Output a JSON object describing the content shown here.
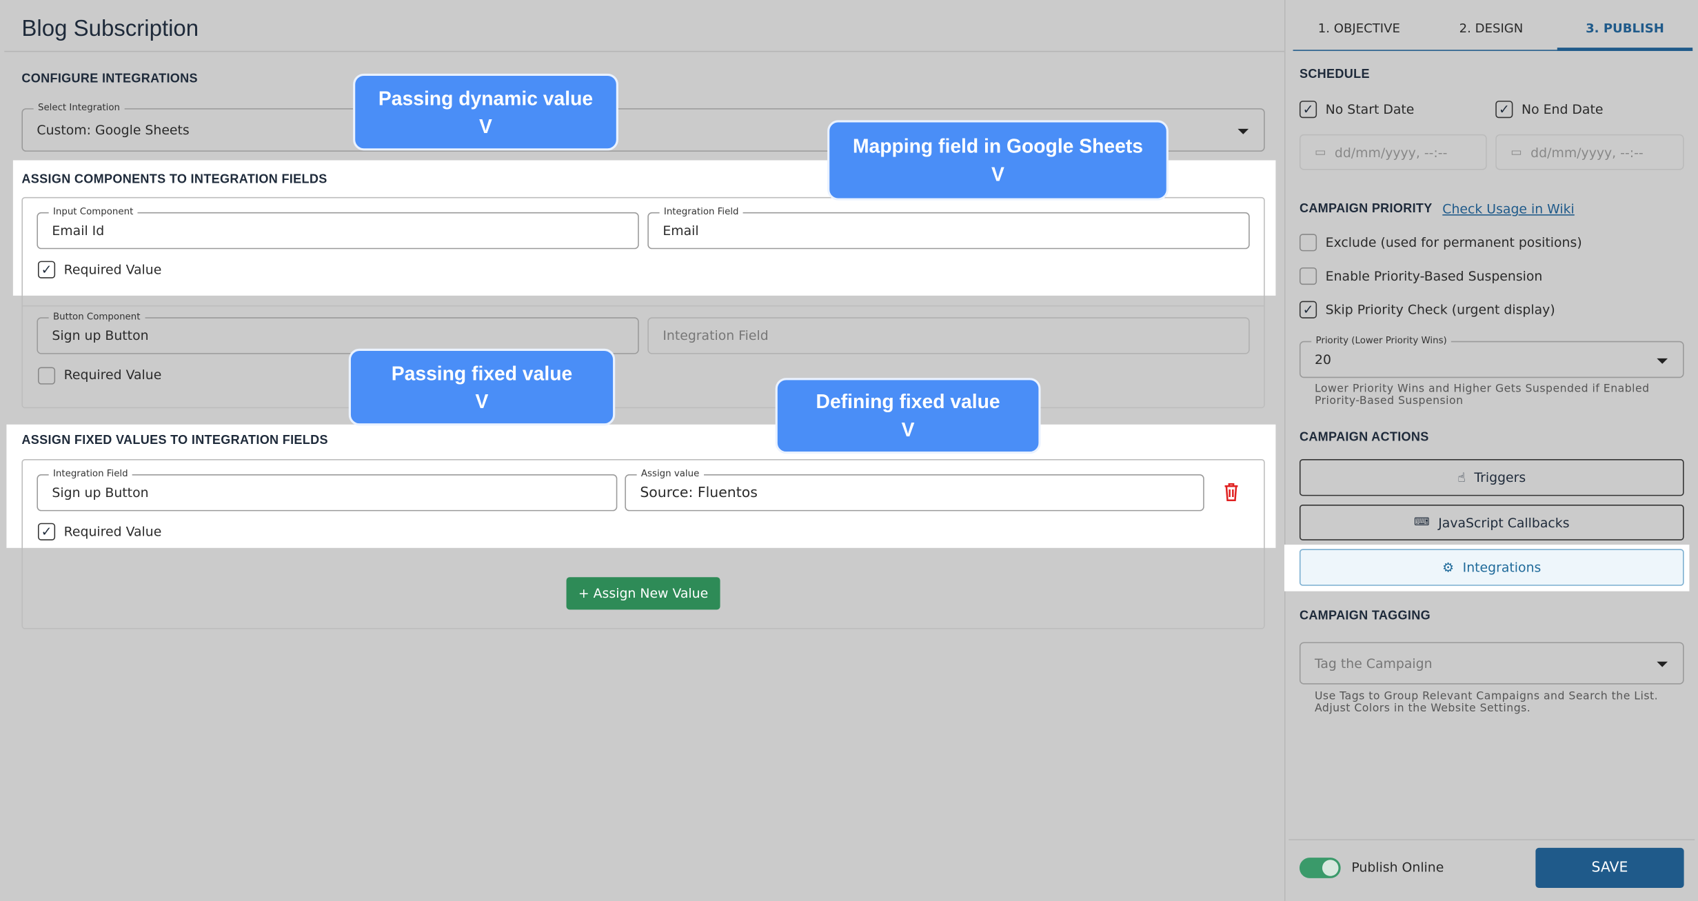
{
  "main": {
    "title": "Blog Subscription",
    "configure_heading": "CONFIGURE INTEGRATIONS",
    "select_integration": {
      "label": "Select Integration",
      "value": "Custom: Google Sheets"
    },
    "assign_components_heading": "ASSIGN COMPONENTS TO INTEGRATION FIELDS",
    "component_rows": [
      {
        "component_label": "Input Component",
        "component_value": "Email Id",
        "field_label": "Integration Field",
        "field_value": "Email",
        "field_placeholder": "",
        "required_label": "Required Value",
        "required": true
      },
      {
        "component_label": "Button Component",
        "component_value": "Sign up Button",
        "field_label": "",
        "field_value": "",
        "field_placeholder": "Integration Field",
        "required_label": "Required Value",
        "required": false
      }
    ],
    "assign_fixed_heading": "ASSIGN FIXED VALUES TO INTEGRATION FIELDS",
    "fixed_rows": [
      {
        "field_label": "Integration Field",
        "field_value": "Sign up Button",
        "value_label": "Assign value",
        "value": "Source: Fluentos",
        "required_label": "Required Value",
        "required": true
      }
    ],
    "assign_new_button": "+ Assign New Value"
  },
  "callouts": [
    "Passing dynamic value",
    "Mapping field in Google Sheets",
    "Passing fixed value",
    "Defining fixed value"
  ],
  "callout_arrow": "V",
  "sidebar": {
    "tabs": [
      {
        "label": "1. OBJECTIVE"
      },
      {
        "label": "2. DESIGN"
      },
      {
        "label": "3. PUBLISH",
        "active": true
      }
    ],
    "schedule_heading": "SCHEDULE",
    "no_start_date": {
      "label": "No Start Date",
      "checked": true
    },
    "no_end_date": {
      "label": "No End Date",
      "checked": true
    },
    "date_placeholder": "dd/mm/yyyy, --:--",
    "priority_heading": "CAMPAIGN PRIORITY",
    "wiki_link": "Check Usage in Wiki",
    "priority_options": [
      {
        "label": "Exclude (used for permanent positions)",
        "checked": false
      },
      {
        "label": "Enable Priority-Based Suspension",
        "checked": false
      },
      {
        "label": "Skip Priority Check (urgent display)",
        "checked": true
      }
    ],
    "priority_select": {
      "label": "Priority (Lower Priority Wins)",
      "value": "20"
    },
    "priority_help": "Lower Priority Wins and Higher Gets Suspended if Enabled Priority-Based Suspension",
    "actions_heading": "CAMPAIGN ACTIONS",
    "actions": [
      "Triggers",
      "JavaScript Callbacks",
      "Integrations"
    ],
    "tagging_heading": "CAMPAIGN TAGGING",
    "tag_placeholder": "Tag the Campaign",
    "tag_help": "Use Tags to Group Relevant Campaigns and Search the List. Adjust Colors in the Website Settings.",
    "publish_online": {
      "label": "Publish Online",
      "on": true
    },
    "save_button": "SAVE"
  },
  "colors": {
    "accent": "#1f5a8a",
    "callout": "#4a8ef7",
    "green": "#2e8b57",
    "delete": "#e02020",
    "toggle": "#3a9a6a"
  }
}
